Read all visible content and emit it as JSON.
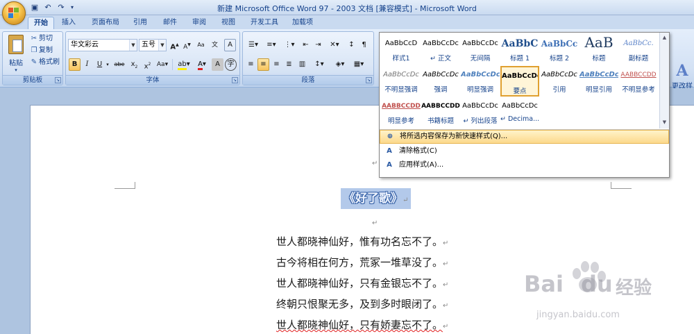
{
  "window": {
    "title": "新建 Microsoft Office Word 97 - 2003 文档 [兼容模式] - Microsoft Word"
  },
  "tabs": [
    "开始",
    "插入",
    "页面布局",
    "引用",
    "邮件",
    "审阅",
    "视图",
    "开发工具",
    "加载项"
  ],
  "clipboard": {
    "paste": "粘贴",
    "cut": "剪切",
    "copy": "复制",
    "format_painter": "格式刷",
    "group_label": "剪贴板"
  },
  "font": {
    "name": "华文彩云",
    "size": "五号",
    "group_label": "字体"
  },
  "paragraph": {
    "group_label": "段落"
  },
  "styles_gallery": {
    "rows": [
      [
        {
          "preview": "AaBbCcD",
          "name": "样式1"
        },
        {
          "preview": "AaBbCcDc",
          "name": "↵ 正文"
        },
        {
          "preview": "AaBbCcDc",
          "name": "无间隔"
        },
        {
          "preview": "AaBbC",
          "name": "标题 1"
        },
        {
          "preview": "AaBbCc",
          "name": "标题 2"
        },
        {
          "preview": "AaB",
          "name": "标题"
        },
        {
          "preview": "AaBbCc.",
          "name": "副标题"
        }
      ],
      [
        {
          "preview": "AaBbCcDc",
          "name": "不明显强调"
        },
        {
          "preview": "AaBbCcDc",
          "name": "强调"
        },
        {
          "preview": "AaBbCcDc",
          "name": "明显强调"
        },
        {
          "preview": "AaBbCcDc",
          "name": "要点"
        },
        {
          "preview": "AaBbCcDc",
          "name": "引用"
        },
        {
          "preview": "AaBbCcDc",
          "name": "明显引用"
        },
        {
          "preview": "AABBCCDD",
          "name": "不明显参考"
        }
      ],
      [
        {
          "preview": "AABBCCDD",
          "name": "明显参考"
        },
        {
          "preview": "AABBCCDD",
          "name": "书籍标题"
        },
        {
          "preview": "AaBbCcDc",
          "name": "↵ 列出段落"
        },
        {
          "preview": "AaBbCcDc",
          "name": "↵ Decima..."
        }
      ]
    ],
    "menu": [
      {
        "icon": "⊕",
        "label": "将所选内容保存为新快速样式(Q)..."
      },
      {
        "icon": "A",
        "label": "清除格式(C)"
      },
      {
        "icon": "A",
        "label": "应用样式(A)..."
      }
    ]
  },
  "change_styles": {
    "label_1": "更改样式",
    "label_2": "▾"
  },
  "document": {
    "title": "《好了歌》",
    "lines": [
      "世人都晓神仙好，惟有功名忘不了。",
      "古今将相在何方，荒冢一堆草没了。",
      "世人都晓神仙好，只有金银忘不了。",
      "终朝只恨聚无多，及到多时眼闭了。",
      "世人都晓神仙好，只有娇妻忘不了。"
    ],
    "para_mark": "↵"
  },
  "watermark": {
    "brand": "Bai",
    "brand2": "du",
    "cn": "经验",
    "url": "jingyan.baidu.com"
  }
}
